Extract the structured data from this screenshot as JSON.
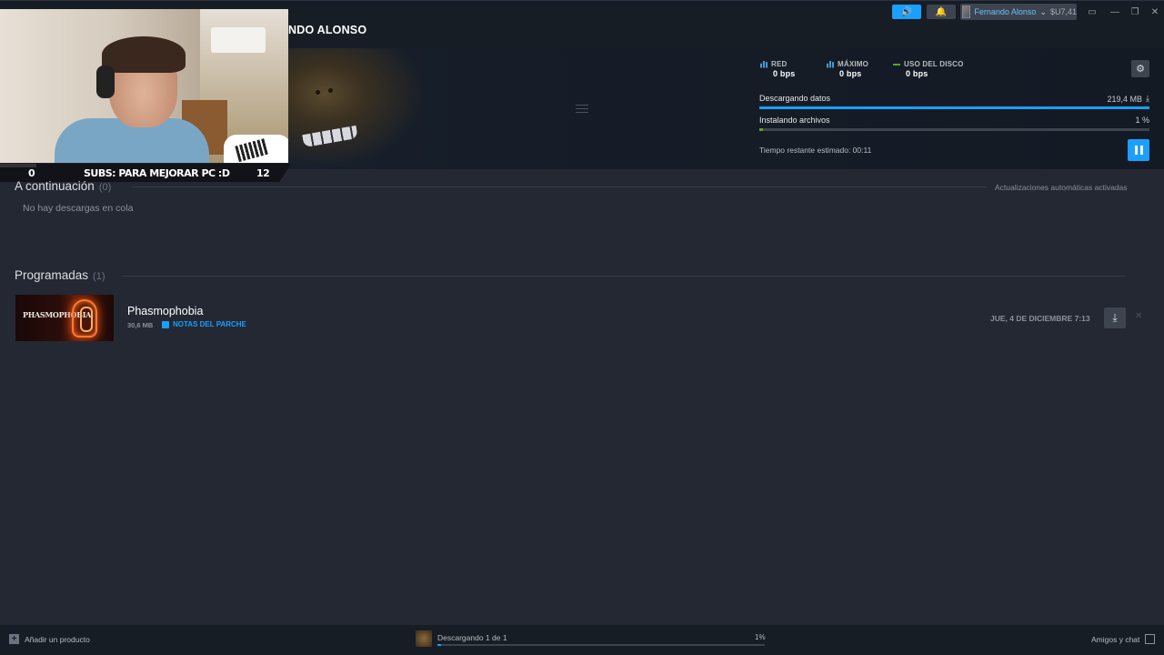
{
  "topbar": {
    "announce_icon": "megaphone-icon",
    "bell_icon": "bell-icon",
    "account_name": "Fernando Alonso",
    "account_caret": "⌄",
    "balance": "$U7,41"
  },
  "header": {
    "title": "NDO ALONSO"
  },
  "stats": {
    "network_label": "RED",
    "network_value": "0 bps",
    "peak_label": "MÁXIMO",
    "peak_value": "0 bps",
    "disk_label": "USO DEL DISCO",
    "disk_value": "0 bps"
  },
  "progress": {
    "downloading_label": "Descargando datos",
    "downloading_amount": "219,4 MB",
    "downloading_fraction": 1.0,
    "installing_label": "Instalando archivos",
    "installing_amount": "1 %",
    "installing_fraction": 0.01,
    "eta": "Tiempo restante estimado: 00:11"
  },
  "stream_overlay": {
    "left_count": "0",
    "banner_text": "SUBS: PARA MEJORAR PC :D",
    "right_count": "12"
  },
  "queue": {
    "title": "A continuación",
    "count": "(0)",
    "auto_updates": "Actualizaciones automáticas activadas",
    "empty_text": "No hay descargas en cola"
  },
  "scheduled": {
    "title": "Programadas",
    "count": "(1)",
    "items": [
      {
        "thumb_title": "PHASMOPHOBIA",
        "name": "Phasmophobia",
        "size": "30,6 MB",
        "patch_notes": "NOTAS DEL PARCHE",
        "date": "JUE, 4 DE DICIEMBRE 7:13"
      }
    ]
  },
  "footer": {
    "add_product": "Añadir un producto",
    "status": "Descargando 1 de 1",
    "percent": "1%",
    "progress_fraction": 0.01,
    "friends": "Amigos y chat"
  },
  "colors": {
    "accent": "#1a9fff",
    "disk_green": "#5ba32b",
    "background": "#232833"
  }
}
